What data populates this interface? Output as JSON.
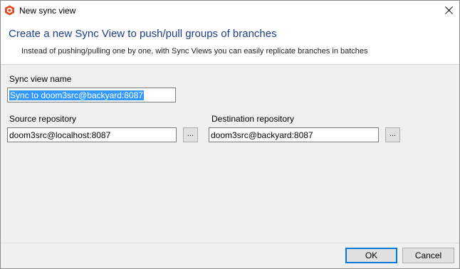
{
  "window": {
    "title": "New sync view",
    "close_icon": "close-icon"
  },
  "header": {
    "title": "Create a new Sync View to push/pull groups of branches",
    "subtitle": "Instead of pushing/pulling one by one, with Sync Views you can easily replicate branches in batches",
    "title_color": "#1e3e8c"
  },
  "form": {
    "sync_view_name_label": "Sync view name",
    "sync_view_name_value": "Sync to doom3src@backyard:8087",
    "source_label": "Source repository",
    "source_value": "doom3src@localhost:8087",
    "source_browse_label": "...",
    "destination_label": "Destination repository",
    "destination_value": "doom3src@backyard:8087",
    "destination_browse_label": "..."
  },
  "footer": {
    "ok_label": "OK",
    "cancel_label": "Cancel"
  },
  "colors": {
    "selection": "#3399ff",
    "accent": "#0078d7",
    "app_icon": "#e8491d"
  }
}
